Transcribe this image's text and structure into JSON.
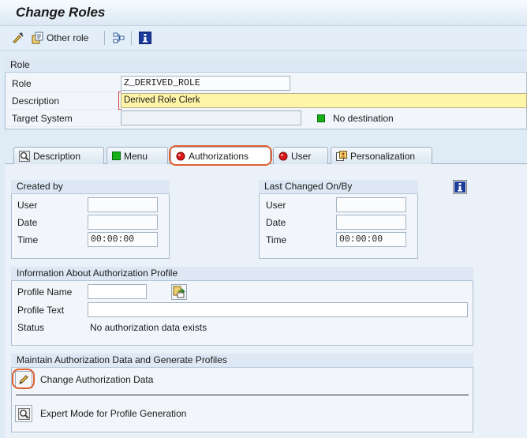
{
  "window": {
    "title": "Change Roles"
  },
  "toolbar": {
    "other_role_label": "Other role"
  },
  "role_section": {
    "header": "Role",
    "role_label": "Role",
    "role_value": "Z_DERIVED_ROLE",
    "description_label": "Description",
    "description_value": "Derived Role Clerk",
    "target_system_label": "Target System",
    "target_system_value": "",
    "destination_status": "No destination"
  },
  "tabs": [
    {
      "label": "Description",
      "icon": "search-icon"
    },
    {
      "label": "Menu",
      "icon": "green-status-icon"
    },
    {
      "label": "Authorizations",
      "icon": "red-status-icon"
    },
    {
      "label": "User",
      "icon": "red-status-icon"
    },
    {
      "label": "Personalization",
      "icon": "personalization-icon"
    }
  ],
  "created_by": {
    "header": "Created by",
    "user_label": "User",
    "user_value": "",
    "date_label": "Date",
    "date_value": "",
    "time_label": "Time",
    "time_value": "00:00:00"
  },
  "last_changed": {
    "header": "Last Changed On/By",
    "user_label": "User",
    "user_value": "",
    "date_label": "Date",
    "date_value": "",
    "time_label": "Time",
    "time_value": "00:00:00"
  },
  "auth_profile": {
    "header": "Information About Authorization Profile",
    "profile_name_label": "Profile Name",
    "profile_name_value": "",
    "profile_text_label": "Profile Text",
    "profile_text_value": "",
    "status_label": "Status",
    "status_value": "No authorization data exists"
  },
  "maintain": {
    "header": "Maintain Authorization Data and Generate Profiles",
    "change_auth_label": "Change Authorization Data",
    "expert_mode_label": "Expert Mode for Profile Generation"
  },
  "colors": {
    "green": "#18b018",
    "red": "#d81818",
    "highlight": "#e06030",
    "description_field": "#fff5a8"
  }
}
